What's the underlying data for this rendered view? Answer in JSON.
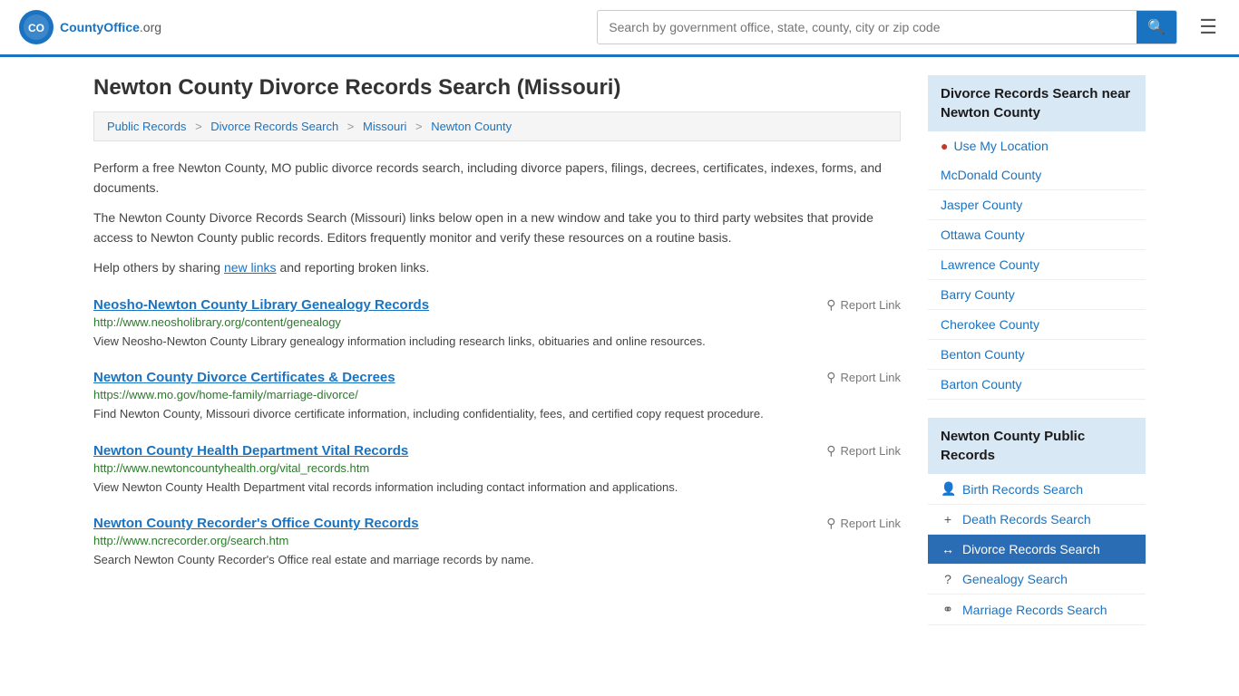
{
  "header": {
    "logo_text": "CountyOffice",
    "logo_suffix": ".org",
    "search_placeholder": "Search by government office, state, county, city or zip code"
  },
  "page": {
    "title": "Newton County Divorce Records Search (Missouri)",
    "breadcrumbs": [
      {
        "label": "Public Records",
        "href": "#"
      },
      {
        "label": "Divorce Records Search",
        "href": "#"
      },
      {
        "label": "Missouri",
        "href": "#"
      },
      {
        "label": "Newton County",
        "href": "#"
      }
    ],
    "description1": "Perform a free Newton County, MO public divorce records search, including divorce papers, filings, decrees, certificates, indexes, forms, and documents.",
    "description2": "The Newton County Divorce Records Search (Missouri) links below open in a new window and take you to third party websites that provide access to Newton County public records. Editors frequently monitor and verify these resources on a routine basis.",
    "description3_prefix": "Help others by sharing ",
    "description3_link": "new links",
    "description3_suffix": " and reporting broken links."
  },
  "results": [
    {
      "title": "Neosho-Newton County Library Genealogy Records",
      "url": "http://www.neosholibrary.org/content/genealogy",
      "desc": "View Neosho-Newton County Library genealogy information including research links, obituaries and online resources.",
      "report_label": "Report Link"
    },
    {
      "title": "Newton County Divorce Certificates & Decrees",
      "url": "https://www.mo.gov/home-family/marriage-divorce/",
      "desc": "Find Newton County, Missouri divorce certificate information, including confidentiality, fees, and certified copy request procedure.",
      "report_label": "Report Link"
    },
    {
      "title": "Newton County Health Department Vital Records",
      "url": "http://www.newtoncountyhealth.org/vital_records.htm",
      "desc": "View Newton County Health Department vital records information including contact information and applications.",
      "report_label": "Report Link"
    },
    {
      "title": "Newton County Recorder's Office County Records",
      "url": "http://www.ncrecorder.org/search.htm",
      "desc": "Search Newton County Recorder's Office real estate and marriage records by name.",
      "report_label": "Report Link"
    }
  ],
  "sidebar": {
    "nearby_header": "Divorce Records Search near Newton County",
    "use_location": "Use My Location",
    "nearby_counties": [
      {
        "label": "McDonald County"
      },
      {
        "label": "Jasper County"
      },
      {
        "label": "Ottawa County"
      },
      {
        "label": "Lawrence County"
      },
      {
        "label": "Barry County"
      },
      {
        "label": "Cherokee County"
      },
      {
        "label": "Benton County"
      },
      {
        "label": "Barton County"
      }
    ],
    "public_records_header": "Newton County Public Records",
    "public_records_items": [
      {
        "label": "Birth Records Search",
        "icon": "person",
        "active": false
      },
      {
        "label": "Death Records Search",
        "icon": "cross",
        "active": false
      },
      {
        "label": "Divorce Records Search",
        "icon": "arrows",
        "active": true
      },
      {
        "label": "Genealogy Search",
        "icon": "question",
        "active": false
      },
      {
        "label": "Marriage Records Search",
        "icon": "rings",
        "active": false
      }
    ]
  }
}
